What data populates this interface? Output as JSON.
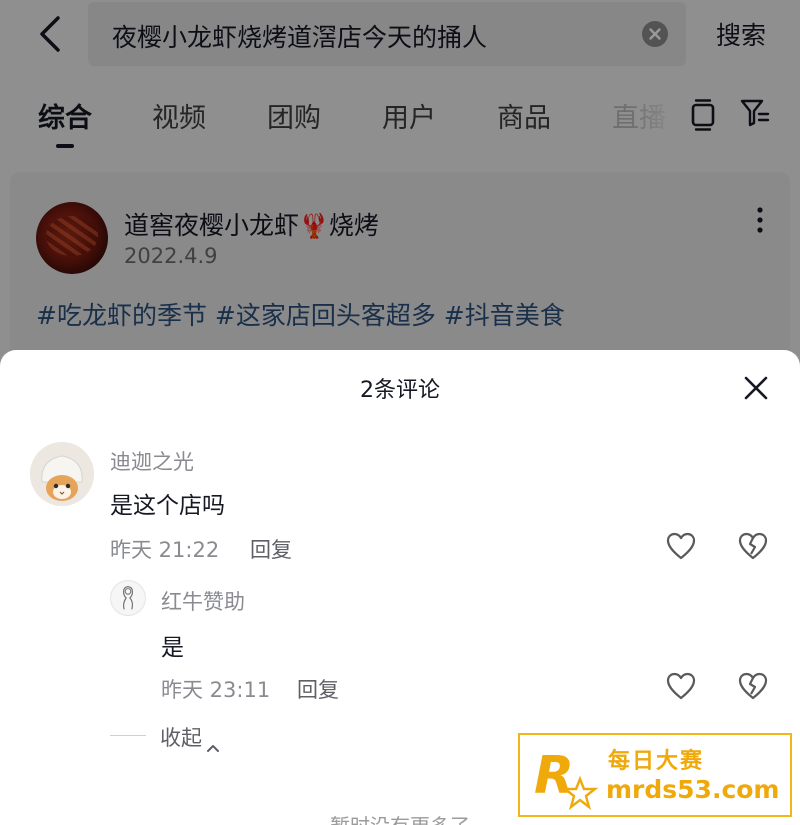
{
  "search": {
    "query": "夜樱小龙虾烧烤道滘店今天的捅人",
    "submit_label": "搜索"
  },
  "tabs": [
    "综合",
    "视频",
    "团购",
    "用户",
    "商品",
    "直播"
  ],
  "post": {
    "title_part1": "道窖夜樱小龙虾",
    "title_emoji": "🦞",
    "title_part2": "烧烤",
    "date": "2022.4.9",
    "tags": "#吃龙虾的季节 #这家店回头客超多 #抖音美食"
  },
  "comments_sheet": {
    "title": "2条评论",
    "comments": [
      {
        "user": "迪迦之光",
        "text": "是这个店吗",
        "time": "昨天 21:22",
        "reply_label": "回复"
      }
    ],
    "replies": [
      {
        "user": "红牛赞助",
        "text": "是",
        "time": "昨天 23:11",
        "reply_label": "回复"
      }
    ],
    "collapse_label": "收起",
    "footer": "暂时没有更多了"
  },
  "watermark": {
    "cn": "每日大赛",
    "url": "mrds53.com"
  },
  "colors": {
    "accent_tag": "#2a4f7c",
    "watermark": "#f0a90a",
    "muted_text": "#8a8b91"
  },
  "icons": [
    "back-arrow-icon",
    "clear-icon",
    "view-mode-icon",
    "filter-icon",
    "more-icon",
    "close-icon",
    "heart-icon",
    "broken-heart-icon",
    "chevron-up-icon"
  ]
}
